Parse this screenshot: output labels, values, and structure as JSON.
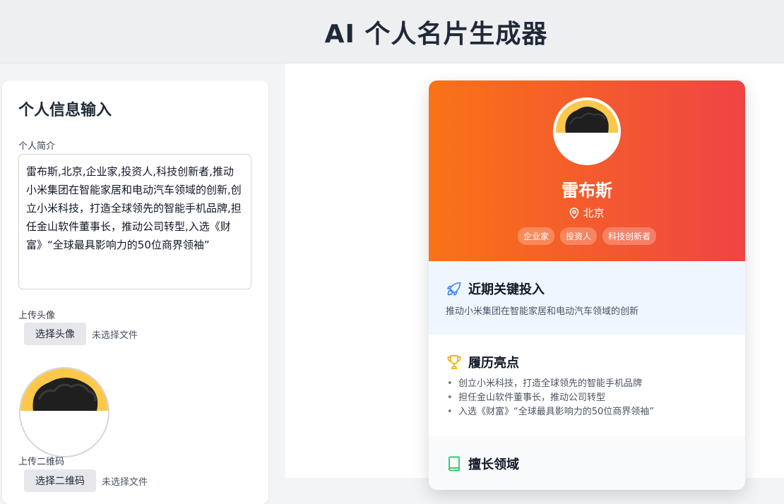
{
  "header": {
    "title": "AI 个人名片生成器"
  },
  "form": {
    "title": "个人信息输入",
    "bio_label": "个人简介",
    "bio_value": "雷布斯,北京,企业家,投资人,科技创新者,推动小米集团在智能家居和电动汽车领域的创新,创立小米科技，打造全球领先的智能手机品牌,担任金山软件董事长，推动公司转型,入选《财富》“全球最具影响力的50位商界领袖”",
    "avatar_label": "上传头像",
    "avatar_button": "选择头像",
    "avatar_status": "未选择文件",
    "qr_label": "上传二维码",
    "qr_button": "选择二维码",
    "qr_status": "未选择文件"
  },
  "card": {
    "name": "雷布斯",
    "location": "北京",
    "tags": [
      "企业家",
      "投资人",
      "科技创新者"
    ],
    "recent": {
      "title": "近期关键投入",
      "text": "推动小米集团在智能家居和电动汽车领域的创新"
    },
    "highlights": {
      "title": "履历亮点",
      "items": [
        "创立小米科技，打造全球领先的智能手机品牌",
        "担任金山软件董事长，推动公司转型",
        "入选《财富》“全球最具影响力的50位商界领袖”"
      ]
    },
    "expertise": {
      "title": "擅长领域"
    }
  },
  "icons": {
    "location": "map-pin-icon",
    "recent": "rocket-icon",
    "highlights": "trophy-icon",
    "expertise": "book-icon"
  },
  "colors": {
    "gradient_start": "#f97316",
    "gradient_end": "#ef4444",
    "rocket": "#3b82f6",
    "trophy": "#eab308",
    "book": "#22c55e"
  }
}
